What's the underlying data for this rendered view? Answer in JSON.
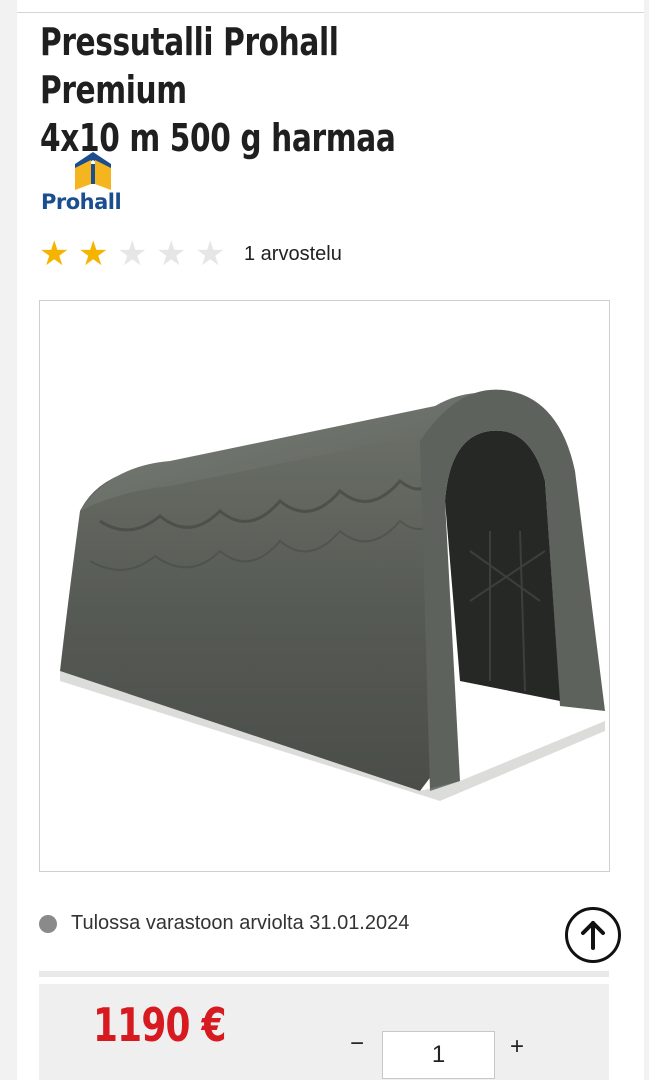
{
  "product": {
    "title_line1": "Pressutalli Prohall Premium",
    "title_line2": "4x10 m 500 g harmaa",
    "brand": "Prohall",
    "image_alt": "Grey storage tent with open front"
  },
  "rating": {
    "score": 2,
    "max": 5,
    "review_count_text": "1 arvostelu"
  },
  "availability": {
    "status_text": "Tulossa varastoon arviolta 31.01.2024",
    "status_color": "#8a8a8a"
  },
  "purchase": {
    "price": "1190 €",
    "quantity": "1",
    "minus_label": "−",
    "plus_label": "+"
  },
  "icons": {
    "star_filled": "star-icon",
    "scroll_top": "arrow-up-circle-icon"
  },
  "colors": {
    "price": "#d71920",
    "star": "#f4b400",
    "brand_blue": "#1a4e8e",
    "brand_yellow": "#f5b51e"
  }
}
